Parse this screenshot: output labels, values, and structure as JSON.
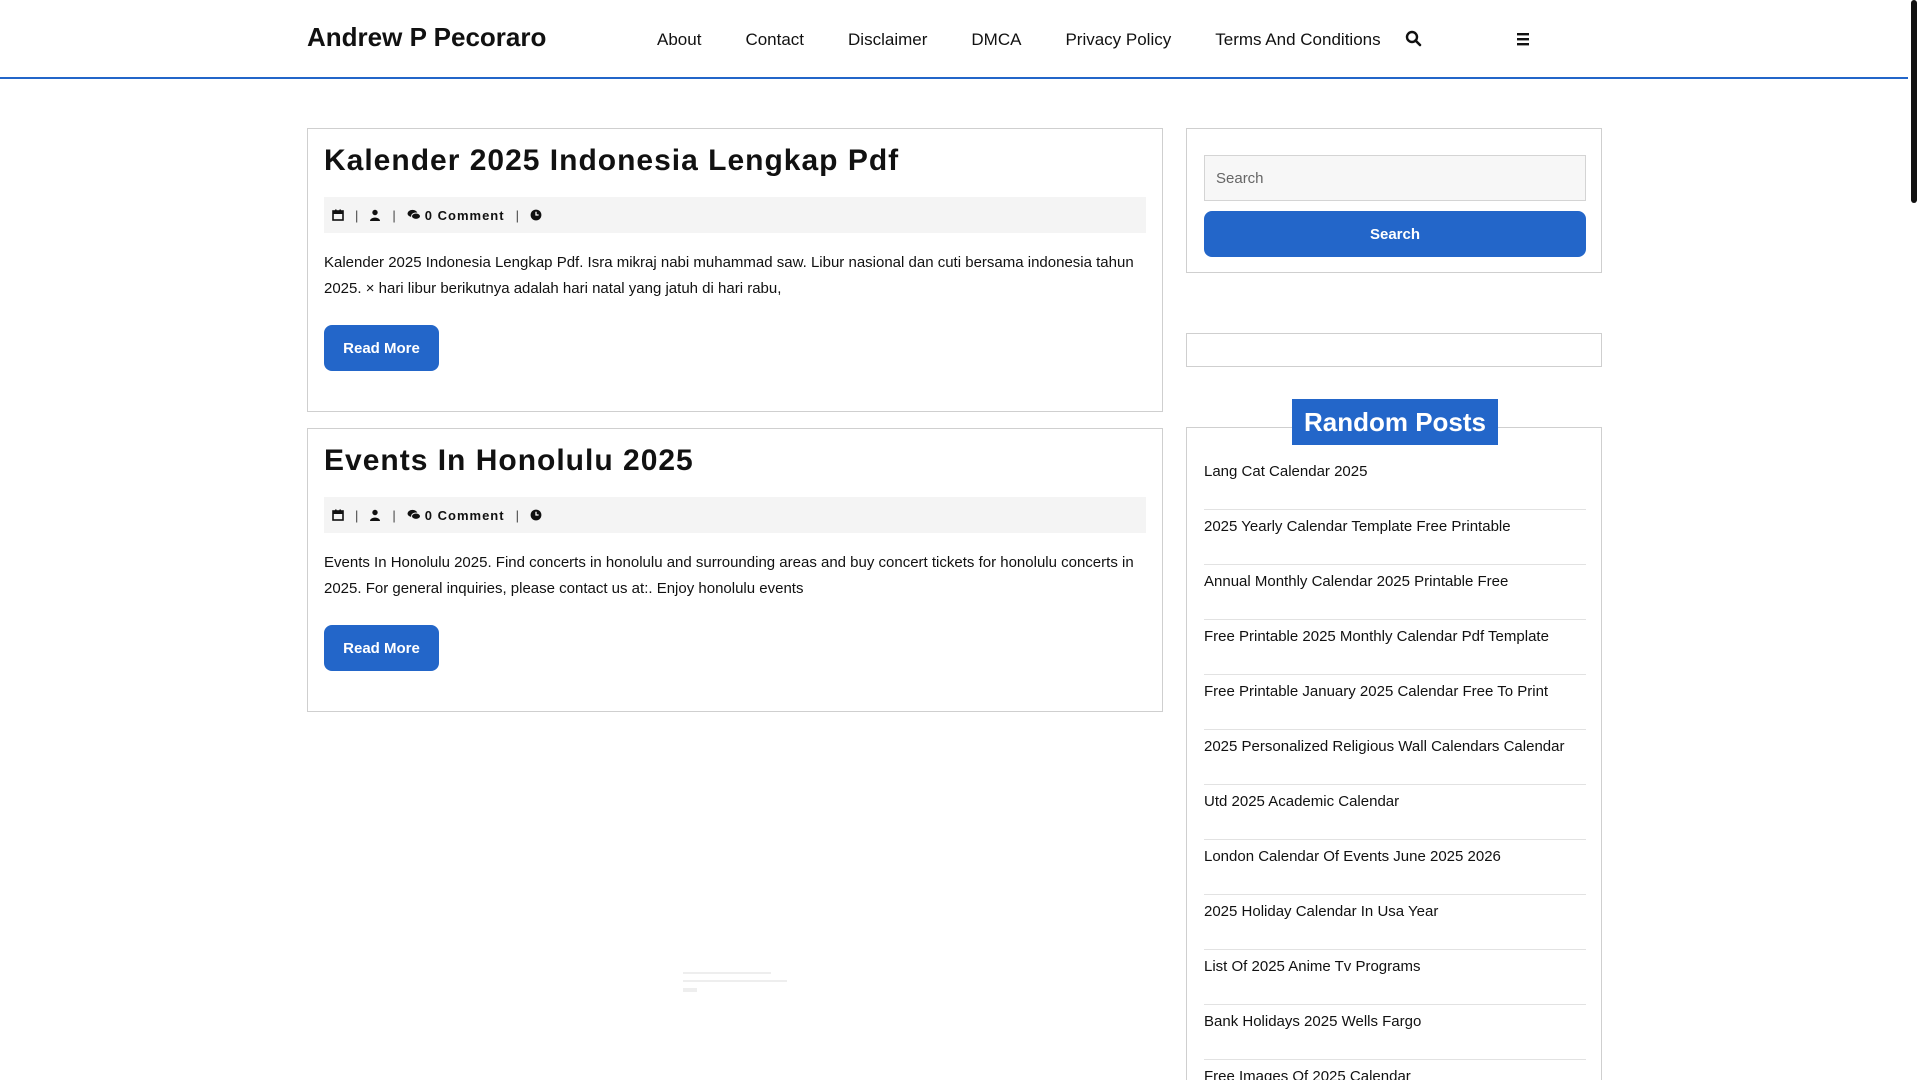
{
  "site": {
    "title": "Andrew P Pecoraro"
  },
  "nav": {
    "items": [
      "About",
      "Contact",
      "Disclaimer",
      "DMCA",
      "Privacy Policy",
      "Terms And Conditions"
    ],
    "search_icon": "search-icon",
    "menu_icon": "menu-icon"
  },
  "posts": [
    {
      "title": "Kalender 2025 Indonesia Lengkap Pdf",
      "meta": {
        "comments": "0 Comment",
        "separator": "|"
      },
      "excerpt": "Kalender 2025 Indonesia Lengkap Pdf. Isra mikraj nabi muhammad saw. Libur nasional dan cuti bersama indonesia tahun 2025. × hari libur berikutnya adalah hari natal yang jatuh di hari rabu,",
      "button": "Read More"
    },
    {
      "title": "Events In Honolulu 2025",
      "meta": {
        "comments": "0 Comment",
        "separator": "|"
      },
      "excerpt": "Events In Honolulu 2025. Find concerts in honolulu and surrounding areas and buy concert tickets for honolulu concerts in 2025. For general inquiries, please contact us at:. Enjoy honolulu events",
      "button": "Read More"
    }
  ],
  "sidebar": {
    "search": {
      "placeholder": "Search",
      "button": "Search"
    },
    "random_posts": {
      "title": "Random Posts",
      "items": [
        "Lang Cat Calendar 2025",
        "2025 Yearly Calendar Template Free Printable",
        "Annual Monthly Calendar 2025 Printable Free",
        "Free Printable 2025 Monthly Calendar Pdf Template",
        "Free Printable January 2025 Calendar Free To Print",
        "2025 Personalized Religious Wall Calendars Calendar",
        "Utd 2025 Academic Calendar",
        "London Calendar Of Events June 2025 2026",
        "2025 Holiday Calendar In Usa Year",
        "List Of 2025 Anime Tv Programs",
        "Bank Holidays 2025 Wells Fargo",
        "Free Images Of 2025 Calendar"
      ]
    }
  },
  "colors": {
    "accent": "#2366c9",
    "border": "#cfcfcf",
    "meta_bg": "#f4f4f4"
  }
}
